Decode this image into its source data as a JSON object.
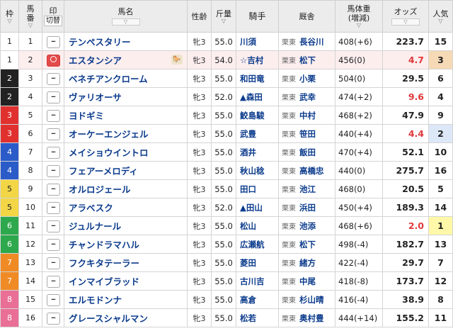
{
  "header": {
    "waku": "枠",
    "umaban_top": "馬",
    "umaban_bottom": "番",
    "mark": "印",
    "mark_sub": "切替",
    "name": "馬名",
    "sex_age": "性齢",
    "kinryo": "斤量",
    "jockey": "騎手",
    "trainer": "厩舎",
    "weight": "馬体重",
    "weight_sub": "(増減)",
    "odds": "オッズ",
    "popularity": "人気",
    "sort_glyph": "▽"
  },
  "colors": {
    "waku": {
      "1": "#ffffff",
      "2": "#222222",
      "3": "#e0312f",
      "4": "#2a5bc9",
      "5": "#f2d645",
      "6": "#2ea84c",
      "7": "#f08a24",
      "8": "#ea6f96"
    },
    "odds_hot": "#e0383b",
    "name_blue": "#0b3b8c"
  },
  "rows": [
    {
      "waku": "1",
      "umaban": "1",
      "mark": "--",
      "name": "テンペスタリー",
      "sex_age": "牝3",
      "kinryo": "55.0",
      "jockey": "川須",
      "region": "栗東",
      "trainer": "長谷川",
      "weight": "408(+6)",
      "odds": "223.7",
      "pop": "15"
    },
    {
      "waku": "1",
      "umaban": "2",
      "mark": "◎",
      "name": "エスタンシア",
      "icon": "horse-icon",
      "sex_age": "牝3",
      "kinryo": "54.0",
      "jockey": "☆吉村",
      "region": "栗東",
      "trainer": "松下",
      "weight": "456(0)",
      "odds": "4.7",
      "pop": "3"
    },
    {
      "waku": "2",
      "umaban": "3",
      "mark": "--",
      "name": "ベネチアンクローム",
      "sex_age": "牝3",
      "kinryo": "55.0",
      "jockey": "和田竜",
      "region": "栗東",
      "trainer": "小栗",
      "weight": "504(0)",
      "odds": "29.5",
      "pop": "6"
    },
    {
      "waku": "2",
      "umaban": "4",
      "mark": "--",
      "name": "ヴァリオーサ",
      "sex_age": "牝3",
      "kinryo": "52.0",
      "jockey": "▲森田",
      "region": "栗東",
      "trainer": "武幸",
      "weight": "474(+2)",
      "odds": "9.6",
      "pop": "4"
    },
    {
      "waku": "3",
      "umaban": "5",
      "mark": "--",
      "name": "ヨドギミ",
      "sex_age": "牝3",
      "kinryo": "55.0",
      "jockey": "鮫島駿",
      "region": "栗東",
      "trainer": "中村",
      "weight": "468(+2)",
      "odds": "47.9",
      "pop": "9"
    },
    {
      "waku": "3",
      "umaban": "6",
      "mark": "--",
      "name": "オーケーエンジェル",
      "sex_age": "牝3",
      "kinryo": "55.0",
      "jockey": "武豊",
      "region": "栗東",
      "trainer": "笹田",
      "weight": "440(+4)",
      "odds": "4.4",
      "pop": "2"
    },
    {
      "waku": "4",
      "umaban": "7",
      "mark": "--",
      "name": "メイショウイントロ",
      "sex_age": "牝3",
      "kinryo": "55.0",
      "jockey": "酒井",
      "region": "栗東",
      "trainer": "飯田",
      "weight": "470(+4)",
      "odds": "52.1",
      "pop": "10"
    },
    {
      "waku": "4",
      "umaban": "8",
      "mark": "--",
      "name": "フェアーメロディ",
      "sex_age": "牝3",
      "kinryo": "55.0",
      "jockey": "秋山稔",
      "region": "栗東",
      "trainer": "高橋忠",
      "weight": "440(0)",
      "odds": "275.7",
      "pop": "16"
    },
    {
      "waku": "5",
      "umaban": "9",
      "mark": "--",
      "name": "オルロジェール",
      "sex_age": "牝3",
      "kinryo": "55.0",
      "jockey": "田口",
      "region": "栗東",
      "trainer": "池江",
      "weight": "468(0)",
      "odds": "20.5",
      "pop": "5"
    },
    {
      "waku": "5",
      "umaban": "10",
      "mark": "--",
      "name": "アラベスク",
      "sex_age": "牝3",
      "kinryo": "52.0",
      "jockey": "▲田山",
      "region": "栗東",
      "trainer": "浜田",
      "weight": "450(+4)",
      "odds": "189.3",
      "pop": "14"
    },
    {
      "waku": "6",
      "umaban": "11",
      "mark": "--",
      "name": "ジュルナール",
      "sex_age": "牝3",
      "kinryo": "55.0",
      "jockey": "松山",
      "region": "栗東",
      "trainer": "池添",
      "weight": "468(+6)",
      "odds": "2.0",
      "pop": "1"
    },
    {
      "waku": "6",
      "umaban": "12",
      "mark": "--",
      "name": "チャンドラマハル",
      "sex_age": "牝3",
      "kinryo": "55.0",
      "jockey": "広瀬航",
      "region": "栗東",
      "trainer": "松下",
      "weight": "498(-4)",
      "odds": "182.7",
      "pop": "13"
    },
    {
      "waku": "7",
      "umaban": "13",
      "mark": "--",
      "name": "フクキタテーラー",
      "sex_age": "牝3",
      "kinryo": "55.0",
      "jockey": "菱田",
      "region": "栗東",
      "trainer": "緒方",
      "weight": "422(-4)",
      "odds": "29.7",
      "pop": "7"
    },
    {
      "waku": "7",
      "umaban": "14",
      "mark": "--",
      "name": "インマイブラッド",
      "sex_age": "牝3",
      "kinryo": "55.0",
      "jockey": "古川吉",
      "region": "栗東",
      "trainer": "中尾",
      "weight": "418(-8)",
      "odds": "173.7",
      "pop": "12"
    },
    {
      "waku": "8",
      "umaban": "15",
      "mark": "--",
      "name": "エルモドンナ",
      "sex_age": "牝3",
      "kinryo": "55.0",
      "jockey": "高倉",
      "region": "栗東",
      "trainer": "杉山晴",
      "weight": "416(-4)",
      "odds": "38.9",
      "pop": "8"
    },
    {
      "waku": "8",
      "umaban": "16",
      "mark": "--",
      "name": "グレースシャルマン",
      "sex_age": "牝3",
      "kinryo": "55.0",
      "jockey": "松若",
      "region": "栗東",
      "trainer": "奥村豊",
      "weight": "444(+14)",
      "odds": "155.2",
      "pop": "11"
    }
  ]
}
